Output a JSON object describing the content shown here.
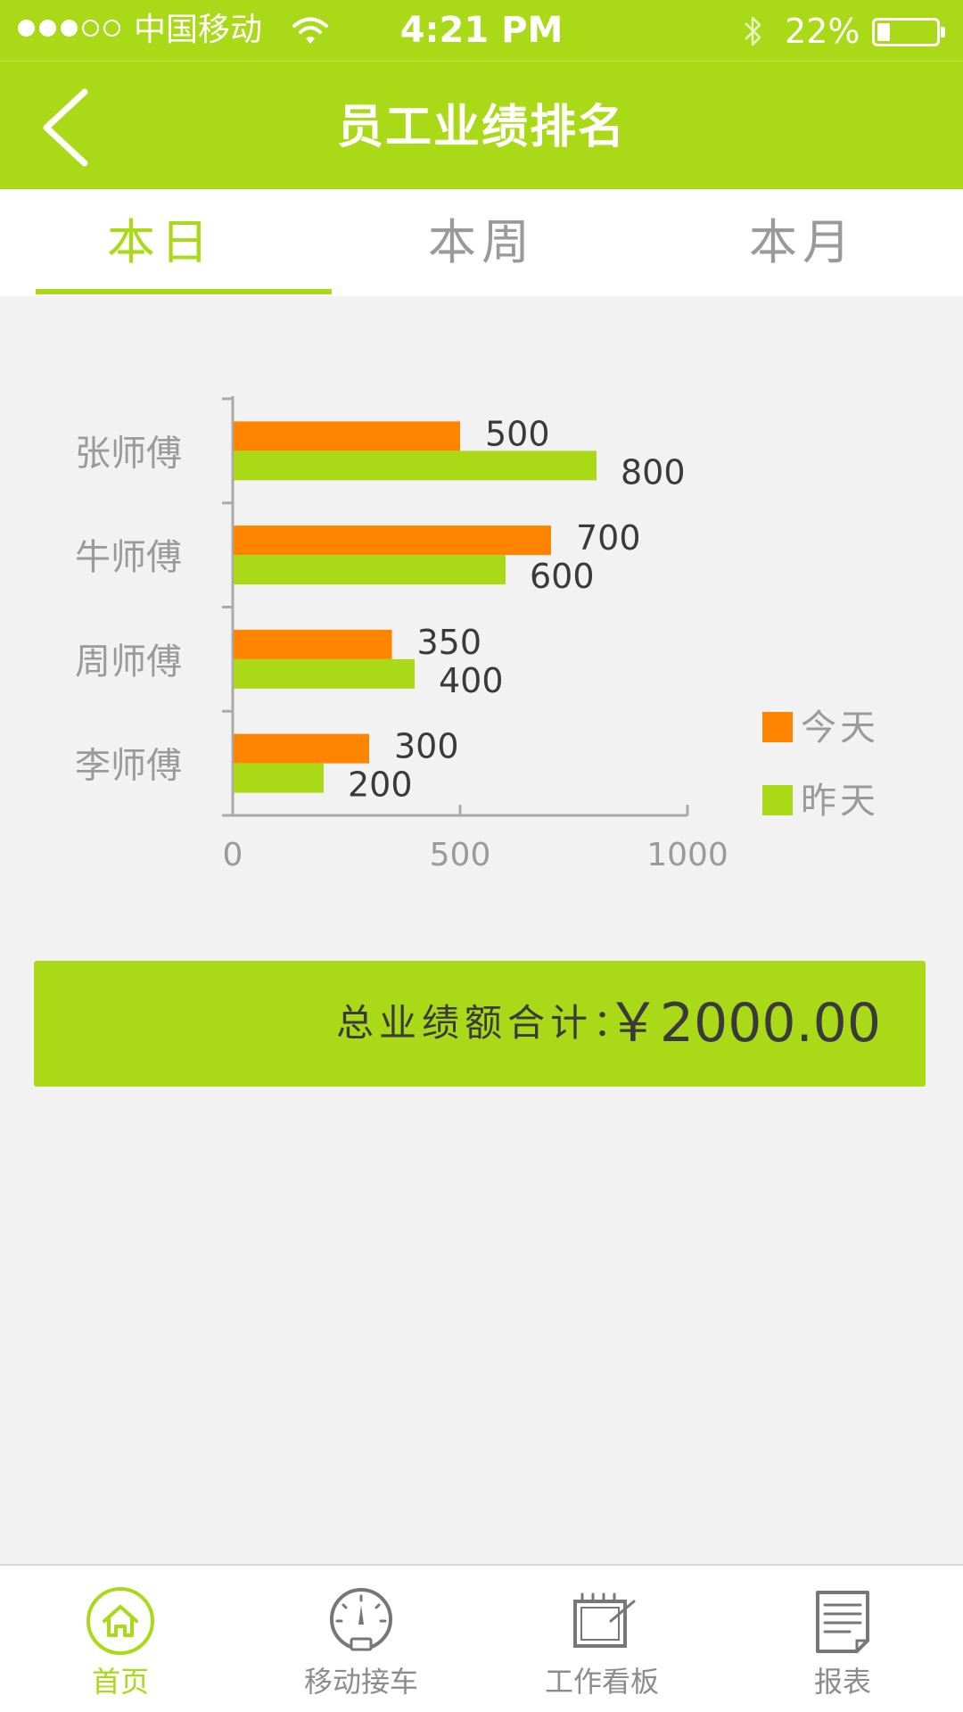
{
  "status_bar": {
    "carrier": "中国移动",
    "time": "4:21 PM",
    "battery": "22%",
    "battery_level": 0.22
  },
  "header": {
    "title": "员工业绩排名",
    "back_icon": "chevron-left-icon"
  },
  "tabs": [
    {
      "label": "本日",
      "active": true
    },
    {
      "label": "本周",
      "active": false
    },
    {
      "label": "本月",
      "active": false
    }
  ],
  "chart_data": {
    "type": "bar",
    "orientation": "horizontal",
    "categories": [
      "张师傅",
      "牛师傅",
      "周师傅",
      "李师傅"
    ],
    "series": [
      {
        "name": "今天",
        "values": [
          500,
          700,
          350,
          300
        ],
        "color": "#ff8400"
      },
      {
        "name": "昨天",
        "values": [
          800,
          600,
          400,
          200
        ],
        "color": "#a9d917"
      }
    ],
    "xlim": [
      0,
      1000
    ],
    "x_ticks": [
      "0",
      "500",
      "1000"
    ],
    "grid": false,
    "legend_position": "right"
  },
  "total": {
    "label": "总业绩额合计：",
    "value": "￥2000.00"
  },
  "bottom_nav": [
    {
      "label": "首页",
      "icon": "home-icon",
      "active": true
    },
    {
      "label": "移动接车",
      "icon": "gauge-icon",
      "active": false
    },
    {
      "label": "工作看板",
      "icon": "board-icon",
      "active": false
    },
    {
      "label": "报表",
      "icon": "report-icon",
      "active": false
    }
  ],
  "colors": {
    "accent": "#a9d917",
    "today": "#ff8400",
    "text_dark": "#3a3a3a",
    "text_muted": "#9a9a9a",
    "background": "#f2f2f2"
  }
}
